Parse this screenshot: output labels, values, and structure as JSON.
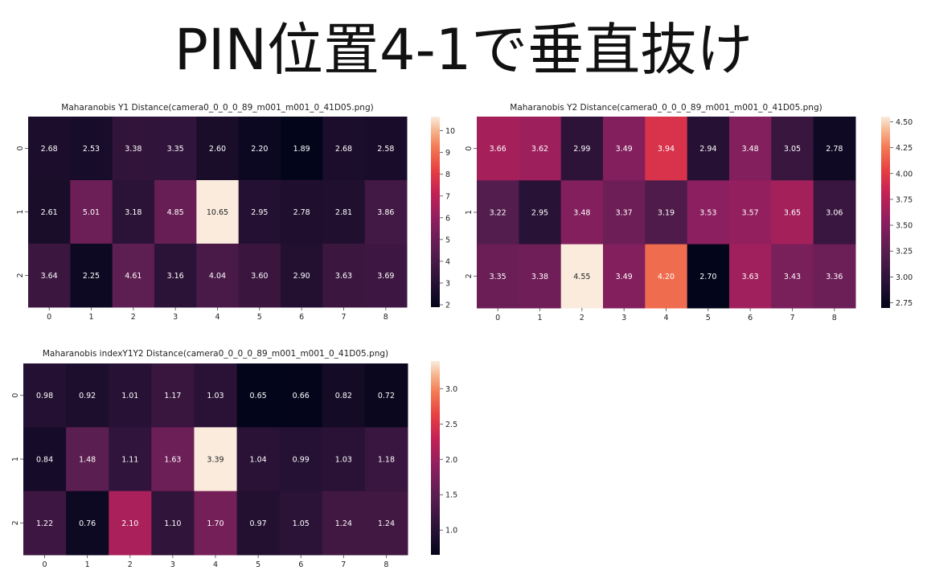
{
  "page": {
    "title": "PIN位置4-1で垂直抜け"
  },
  "chart_data": [
    {
      "type": "heatmap",
      "title": "Maharanobis Y1 Distance(camera0_0_0_0_89_m001_m001_0_41D05.png)",
      "x_ticks": [
        "0",
        "1",
        "2",
        "3",
        "4",
        "5",
        "6",
        "7",
        "8"
      ],
      "y_ticks": [
        "0",
        "1",
        "2"
      ],
      "values": [
        [
          2.68,
          2.53,
          3.38,
          3.35,
          2.6,
          2.2,
          1.89,
          2.68,
          2.58
        ],
        [
          2.61,
          5.01,
          3.18,
          4.85,
          10.65,
          2.95,
          2.78,
          2.81,
          3.86
        ],
        [
          3.64,
          2.25,
          4.61,
          3.16,
          4.04,
          3.6,
          2.9,
          3.63,
          3.69
        ]
      ],
      "colorbar": {
        "vmin": 1.89,
        "vmax": 10.65,
        "ticks": [
          "2",
          "3",
          "4",
          "5",
          "6",
          "7",
          "8",
          "9",
          "10"
        ]
      },
      "colormap": "rocket"
    },
    {
      "type": "heatmap",
      "title": "Maharanobis Y2 Distance(camera0_0_0_0_89_m001_m001_0_41D05.png)",
      "x_ticks": [
        "0",
        "1",
        "2",
        "3",
        "4",
        "5",
        "6",
        "7",
        "8"
      ],
      "y_ticks": [
        "0",
        "1",
        "2"
      ],
      "values": [
        [
          3.66,
          3.62,
          2.99,
          3.49,
          3.94,
          2.94,
          3.48,
          3.05,
          2.78
        ],
        [
          3.22,
          2.95,
          3.48,
          3.37,
          3.19,
          3.53,
          3.57,
          3.65,
          3.06
        ],
        [
          3.35,
          3.38,
          4.55,
          3.49,
          4.2,
          2.7,
          3.63,
          3.43,
          3.36
        ]
      ],
      "colorbar": {
        "vmin": 2.7,
        "vmax": 4.55,
        "ticks": [
          "2.75",
          "3.00",
          "3.25",
          "3.50",
          "3.75",
          "4.00",
          "4.25",
          "4.50"
        ]
      },
      "colormap": "rocket"
    },
    {
      "type": "heatmap",
      "title": "Maharanobis indexY1Y2 Distance(camera0_0_0_0_89_m001_m001_0_41D05.png)",
      "x_ticks": [
        "0",
        "1",
        "2",
        "3",
        "4",
        "5",
        "6",
        "7",
        "8"
      ],
      "y_ticks": [
        "0",
        "1",
        "2"
      ],
      "values": [
        [
          0.98,
          0.92,
          1.01,
          1.17,
          1.03,
          0.65,
          0.66,
          0.82,
          0.72
        ],
        [
          0.84,
          1.48,
          1.11,
          1.63,
          3.39,
          1.04,
          0.99,
          1.03,
          1.18
        ],
        [
          1.22,
          0.76,
          2.1,
          1.1,
          1.7,
          0.97,
          1.05,
          1.24,
          1.24
        ]
      ],
      "colorbar": {
        "vmin": 0.65,
        "vmax": 3.39,
        "ticks": [
          "1.0",
          "1.5",
          "2.0",
          "2.5",
          "3.0"
        ]
      },
      "colormap": "rocket"
    }
  ]
}
